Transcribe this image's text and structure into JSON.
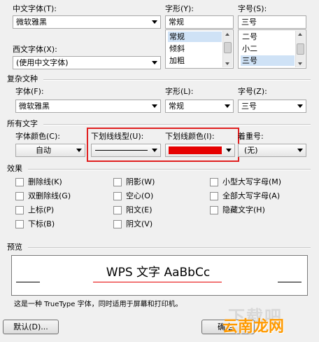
{
  "chinese_font": {
    "label": "中文字体(T):",
    "value": "微软雅黑"
  },
  "western_font": {
    "label": "西文字体(X):",
    "value": "(使用中文字体)"
  },
  "font_style": {
    "label": "字形(Y):",
    "value": "常规",
    "options": [
      "常规",
      "倾斜",
      "加粗"
    ],
    "selected": "常规"
  },
  "font_size": {
    "label": "字号(S):",
    "value": "三号",
    "options": [
      "二号",
      "小二",
      "三号"
    ],
    "selected": "三号"
  },
  "complex_script": {
    "title": "复杂文种",
    "font_label": "字体(F):",
    "font_value": "微软雅黑",
    "style_label": "字形(L):",
    "style_value": "常规",
    "size_label": "字号(Z):",
    "size_value": "三号"
  },
  "all_text": {
    "title": "所有文字",
    "font_color_label": "字体颜色(C):",
    "font_color_value": "自动",
    "underline_type_label": "下划线线型(U):",
    "underline_color_label": "下划线颜色(I):",
    "underline_color": "#e60000",
    "emphasis_label": "着重号:",
    "emphasis_value": "(无)"
  },
  "effects": {
    "title": "效果",
    "strikethrough": "删除线(K)",
    "double_strikethrough": "双删除线(G)",
    "superscript": "上标(P)",
    "subscript": "下标(B)",
    "shadow": "阴影(W)",
    "outline": "空心(O)",
    "emboss": "阳文(E)",
    "engrave": "阴文(V)",
    "small_caps": "小型大写字母(M)",
    "all_caps": "全部大写字母(A)",
    "hidden": "隐藏文字(H)"
  },
  "preview": {
    "title": "预览",
    "sample_text": "WPS 文字 AaBbCc",
    "note": "这是一种 TrueType 字体，同时适用于屏幕和打印机。"
  },
  "buttons": {
    "default": "默认(D)...",
    "ok": "确定"
  },
  "watermark": {
    "text": "云南龙网",
    "bg_text": "下载吧"
  },
  "colors": {
    "highlight_red": "#e02020",
    "list_selected": "#cfe2f6"
  }
}
